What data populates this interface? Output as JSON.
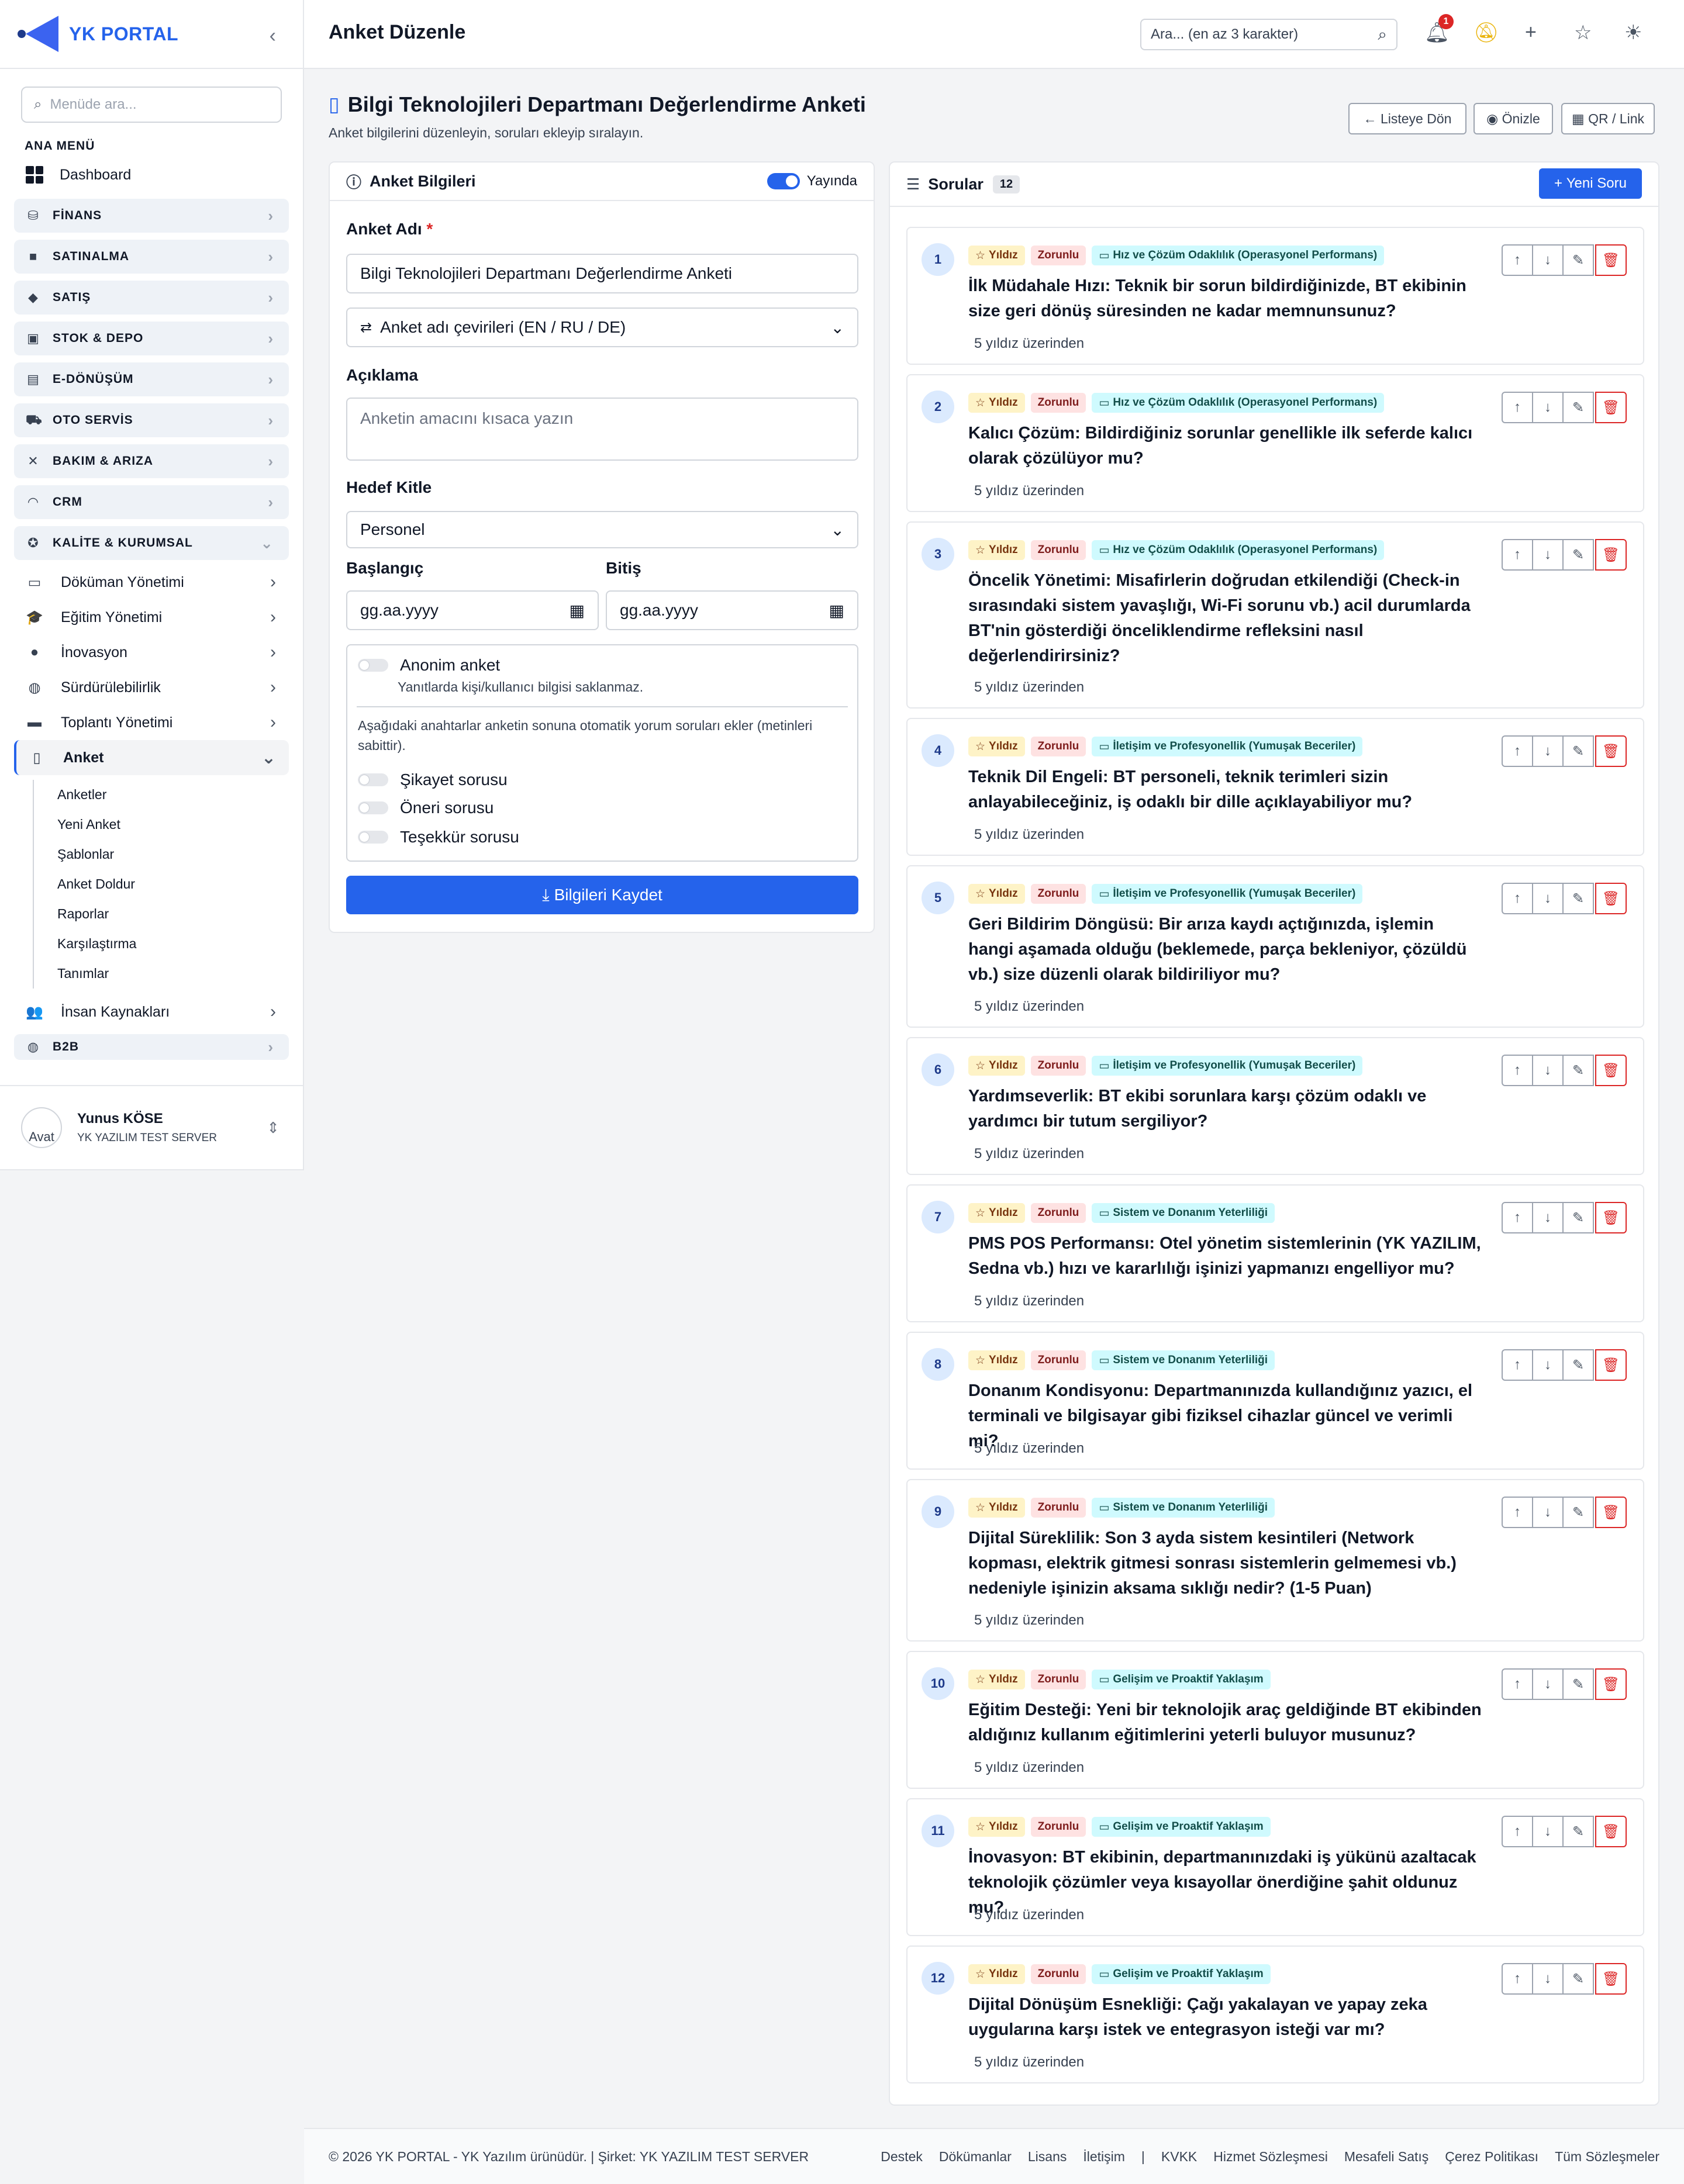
{
  "brand": {
    "name": "YK PORTAL"
  },
  "sidebar": {
    "search_placeholder": "Menüde ara...",
    "menu_title": "ANA MENÜ",
    "dashboard": "Dashboard",
    "groups": [
      {
        "label": "FİNANS",
        "icon": "finance-icon",
        "glyph": "⛁"
      },
      {
        "label": "SATINALMA",
        "icon": "purchase-icon",
        "glyph": "■"
      },
      {
        "label": "SATIŞ",
        "icon": "tag-icon",
        "glyph": "◆"
      },
      {
        "label": "STOK & DEPO",
        "icon": "box-icon",
        "glyph": "▣"
      },
      {
        "label": "E-DÖNÜŞÜM",
        "icon": "document-icon",
        "glyph": "▤"
      },
      {
        "label": "OTO SERVİS",
        "icon": "car-icon",
        "glyph": "⛟"
      },
      {
        "label": "BAKIM & ARIZA",
        "icon": "tools-icon",
        "glyph": "✕"
      },
      {
        "label": "CRM",
        "icon": "headset-icon",
        "glyph": "◠"
      }
    ],
    "kalite": {
      "label": "KALİTE & KURUMSAL",
      "icon": "badge-icon",
      "glyph": "✪"
    },
    "kalite_items": [
      {
        "label": "Döküman Yönetimi",
        "icon": "folder-icon",
        "glyph": "▭"
      },
      {
        "label": "Eğitim Yönetimi",
        "icon": "graduation-icon",
        "glyph": "🎓"
      },
      {
        "label": "İnovasyon",
        "icon": "bulb-icon",
        "glyph": "●"
      },
      {
        "label": "Sürdürülebilirlik",
        "icon": "globe-icon",
        "glyph": "◍"
      },
      {
        "label": "Toplantı Yönetimi",
        "icon": "calendar-icon",
        "glyph": "▬"
      }
    ],
    "anket": {
      "label": "Anket",
      "icon": "clipboard-icon",
      "glyph": "▯"
    },
    "anket_items": [
      "Anketler",
      "Yeni Anket",
      "Şablonlar",
      "Anket Doldur",
      "Raporlar",
      "Karşılaştırma",
      "Tanımlar"
    ],
    "ik": {
      "label": "İnsan Kaynakları",
      "icon": "people-icon",
      "glyph": "👥"
    },
    "b2b": {
      "label": "B2B",
      "icon": "globe-icon",
      "glyph": "◍"
    },
    "user": {
      "name": "Yunus KÖSE",
      "server": "YK YAZILIM TEST SERVER",
      "avatar_alt": "Avat"
    }
  },
  "header": {
    "title": "Anket Düzenle",
    "search_placeholder": "Ara... (en az 3 karakter)",
    "notification_count": "1"
  },
  "page": {
    "title": "Bilgi Teknolojileri Departmanı Değerlendirme Anketi",
    "subtitle": "Anket bilgilerini düzenleyin, soruları ekleyip sıralayın.",
    "back": "Listeye Dön",
    "preview": "Önizle",
    "qr": "QR / Link"
  },
  "info": {
    "heading": "Anket Bilgileri",
    "published_label": "Yayında",
    "published": true,
    "name_label": "Anket Adı",
    "name_value": "Bilgi Teknolojileri Departmanı Değerlendirme Anketi",
    "translations": "Anket adı çevirileri (EN / RU / DE)",
    "desc_label": "Açıklama",
    "desc_placeholder": "Anketin amacını kısaca yazın",
    "target_label": "Hedef Kitle",
    "target_value": "Personel",
    "start_label": "Başlangıç",
    "end_label": "Bitiş",
    "date_placeholder": "gg.aa.yyyy",
    "anon_label": "Anonim anket",
    "anon_desc": "Yanıtlarda kişi/kullanıcı bilgisi saklanmaz.",
    "note": "Aşağıdaki anahtarlar anketin sonuna otomatik yorum soruları ekler (metinleri sabittir).",
    "opt1": "Şikayet sorusu",
    "opt2": "Öneri sorusu",
    "opt3": "Teşekkür sorusu",
    "save": "Bilgileri Kaydet"
  },
  "questions": {
    "heading": "Sorular",
    "count": "12",
    "new_button": "Yeni Soru",
    "tag_star": "Yıldız",
    "tag_required": "Zorunlu",
    "meta": "5 yıldız üzerinden",
    "items": [
      {
        "no": "1",
        "cat": "Hız ve Çözüm Odaklılık (Operasyonel Performans)",
        "text": "İlk Müdahale Hızı: Teknik bir sorun bildirdiğinizde, BT ekibinin size geri dönüş süresinden ne kadar memnunsunuz?"
      },
      {
        "no": "2",
        "cat": "Hız ve Çözüm Odaklılık (Operasyonel Performans)",
        "text": "Kalıcı Çözüm: Bildirdiğiniz sorunlar genellikle ilk seferde kalıcı olarak çözülüyor mu?"
      },
      {
        "no": "3",
        "cat": "Hız ve Çözüm Odaklılık (Operasyonel Performans)",
        "text": "Öncelik Yönetimi: Misafirlerin doğrudan etkilendiği (Check-in sırasındaki sistem yavaşlığı, Wi-Fi sorunu vb.) acil durumlarda BT'nin gösterdiği önceliklendirme refleksini nasıl değerlendirirsiniz?"
      },
      {
        "no": "4",
        "cat": "İletişim ve Profesyonellik (Yumuşak Beceriler)",
        "text": "Teknik Dil Engeli: BT personeli, teknik terimleri sizin anlayabileceğiniz, iş odaklı bir dille açıklayabiliyor mu?"
      },
      {
        "no": "5",
        "cat": "İletişim ve Profesyonellik (Yumuşak Beceriler)",
        "text": "Geri Bildirim Döngüsü: Bir arıza kaydı açtığınızda, işlemin hangi aşamada olduğu (beklemede, parça bekleniyor, çözüldü vb.) size düzenli olarak bildiriliyor mu?"
      },
      {
        "no": "6",
        "cat": "İletişim ve Profesyonellik (Yumuşak Beceriler)",
        "text": "Yardımseverlik: BT ekibi sorunlara karşı çözüm odaklı ve yardımcı bir tutum sergiliyor?"
      },
      {
        "no": "7",
        "cat": "Sistem ve Donanım Yeterliliği",
        "text": "PMS POS Performansı: Otel yönetim sistemlerinin (YK YAZILIM, Sedna vb.) hızı ve kararlılığı işinizi yapmanızı engelliyor mu?"
      },
      {
        "no": "8",
        "cat": "Sistem ve Donanım Yeterliliği",
        "text": "Donanım Kondisyonu: Departmanınızda kullandığınız yazıcı, el terminali ve bilgisayar gibi fiziksel cihazlar güncel ve verimli mi?"
      },
      {
        "no": "9",
        "cat": "Sistem ve Donanım Yeterliliği",
        "text": "Dijital Süreklilik: Son 3 ayda sistem kesintileri (Network kopması, elektrik gitmesi sonrası sistemlerin gelmemesi vb.) nedeniyle işinizin aksama sıklığı nedir? (1-5 Puan)"
      },
      {
        "no": "10",
        "cat": "Gelişim ve Proaktif Yaklaşım",
        "text": "Eğitim Desteği: Yeni bir teknolojik araç geldiğinde BT ekibinden aldığınız kullanım eğitimlerini yeterli buluyor musunuz?"
      },
      {
        "no": "11",
        "cat": "Gelişim ve Proaktif Yaklaşım",
        "text": "İnovasyon: BT ekibinin, departmanınızdaki iş yükünü azaltacak teknolojik çözümler veya kısayollar önerdiğine şahit oldunuz mu?"
      },
      {
        "no": "12",
        "cat": "Gelişim ve Proaktif Yaklaşım",
        "text": "Dijital Dönüşüm Esnekliği: Çağı yakalayan ve yapay zeka uygularına karşı istek ve entegrasyon isteği var mı?"
      }
    ]
  },
  "footer": {
    "copyright": "© 2026 YK PORTAL - YK Yazılım ürünüdür. | Şirket: YK YAZILIM TEST SERVER",
    "links": [
      "Destek",
      "Dökümanlar",
      "Lisans",
      "İletişim",
      "|",
      "KVKK",
      "Hizmet Sözleşmesi",
      "Mesafeli Satış",
      "Çerez Politikası",
      "Tüm Sözleşmeler"
    ]
  },
  "colors": {
    "primary": "#2563eb",
    "danger": "#dc2626"
  }
}
